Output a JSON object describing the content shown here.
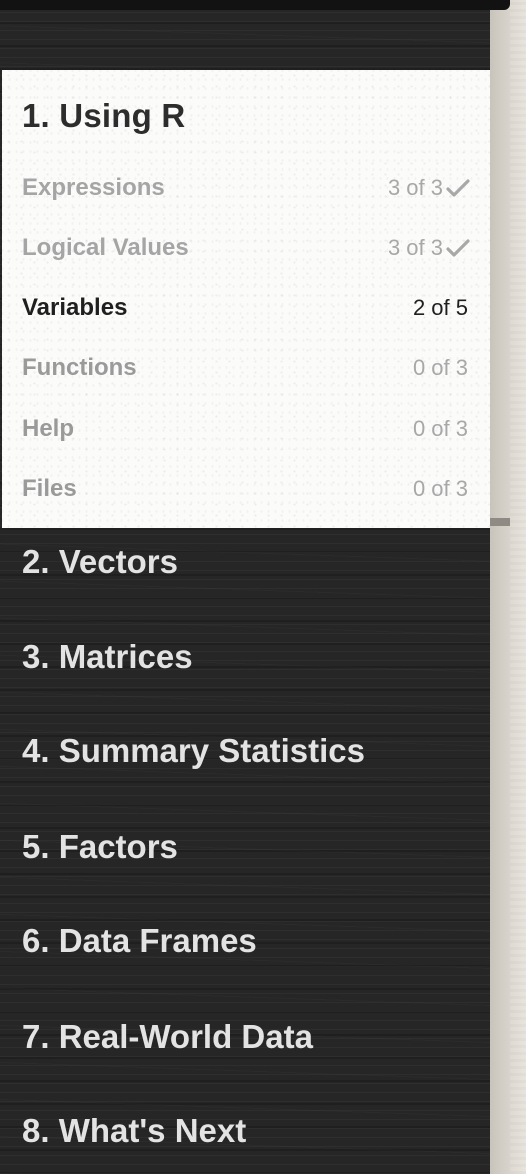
{
  "chapters": [
    {
      "title": "1. Using R",
      "expanded": true,
      "lessons": [
        {
          "label": "Expressions",
          "progress": "3 of 3",
          "completed": true
        },
        {
          "label": "Logical Values",
          "progress": "3 of 3",
          "completed": true
        },
        {
          "label": "Variables",
          "progress": "2 of 5",
          "completed": false,
          "current": true
        },
        {
          "label": "Functions",
          "progress": "0 of 3",
          "completed": false
        },
        {
          "label": "Help",
          "progress": "0 of 3",
          "completed": false
        },
        {
          "label": "Files",
          "progress": "0 of 3",
          "completed": false
        }
      ]
    },
    {
      "title": "2. Vectors"
    },
    {
      "title": "3. Matrices"
    },
    {
      "title": "4. Summary Statistics"
    },
    {
      "title": "5. Factors"
    },
    {
      "title": "6. Data Frames"
    },
    {
      "title": "7. Real-World Data"
    },
    {
      "title": "8. What's Next"
    }
  ],
  "icons": {
    "completed": "check-icon"
  },
  "colors": {
    "panel": "#262626",
    "card": "#fbfbfa",
    "current_text": "#1f1f1f",
    "completed_text": "#a5a5a5",
    "chapter_link_text": "#e3e3e3"
  }
}
